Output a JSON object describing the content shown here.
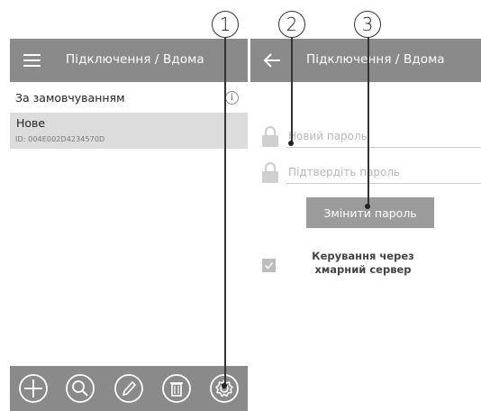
{
  "callouts": [
    "1",
    "2",
    "3"
  ],
  "left_screen": {
    "title": "Підключення / Вдома",
    "section_label": "За замовчуванням",
    "device": {
      "name": "Нове",
      "id": "ID: 004E002D4234570D"
    },
    "bottom_icons": [
      "add-icon",
      "search-icon",
      "edit-icon",
      "delete-icon",
      "settings-icon"
    ]
  },
  "right_screen": {
    "title": "Підключення / Вдома",
    "new_password_placeholder": "Новий пароль",
    "confirm_password_placeholder": "Підтвердіть пароль",
    "change_button": "Змінити пароль",
    "cloud_checkbox_label": "Керування через хмарний сервер",
    "cloud_checkbox_checked": true
  },
  "colors": {
    "appbar": "#8a8a8a",
    "selected_row": "#dcdcdc",
    "button": "#9b9b9b"
  }
}
